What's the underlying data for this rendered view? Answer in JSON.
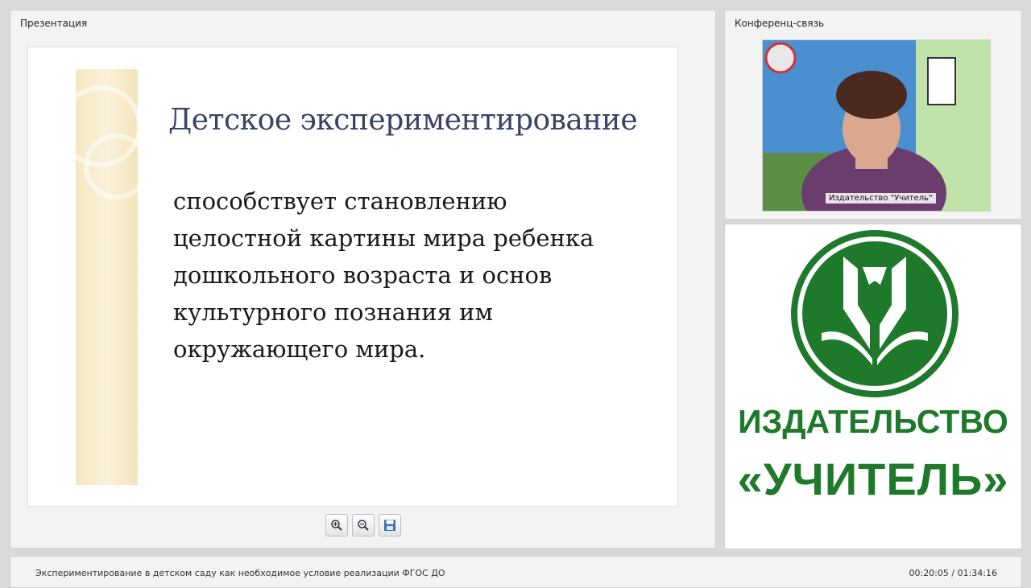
{
  "presentation": {
    "panel_title": "Презентация",
    "slide": {
      "title": "Детское экспериментирование",
      "body_lines": [
        "способствует становлению",
        "целостной картины мира ребенка",
        "дошкольного возраста и основ",
        "культурного познания им",
        "окружающего мира."
      ]
    },
    "toolbar": {
      "zoom_in_icon": "zoom-in-icon",
      "zoom_out_icon": "zoom-out-icon",
      "save_icon": "save-icon"
    }
  },
  "conference": {
    "panel_title": "Конференц-связь",
    "video_caption": "Издательство \"Учитель\""
  },
  "logo": {
    "line1": "ИЗДАТЕЛЬСТВО",
    "line2": "«УЧИТЕЛЬ»",
    "color": "#1e7a2a"
  },
  "status": {
    "lecture_title": "Экспериментирование в детском саду как необходимое условие реализации ФГОС ДО",
    "timecode": "00:20:05 / 01:34:16"
  }
}
